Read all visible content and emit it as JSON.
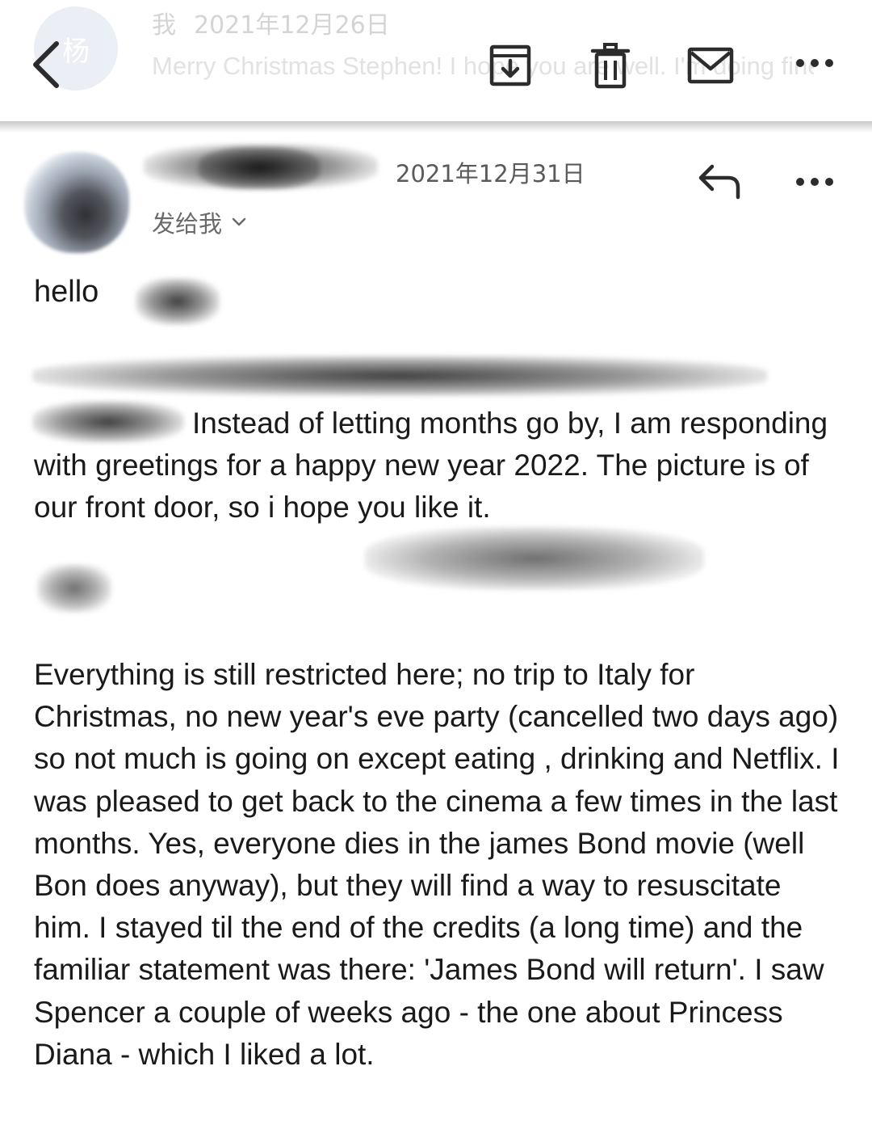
{
  "toolbar": {
    "back_icon": "chevron-left-icon",
    "previous_message": {
      "avatar_char": "杨",
      "sender": "我",
      "date": "2021年12月26日",
      "snippet": "Merry Christmas Stephen! I hope you are well. I'm doing fine. Recent..."
    },
    "actions": [
      "archive-icon",
      "trash-icon",
      "mail-icon",
      "more-icon"
    ]
  },
  "message": {
    "date": "2021年12月31日",
    "recipient_label": "发给我",
    "reply_icon": "reply-icon",
    "more_icon": "more-icon",
    "greeting": "hello",
    "paragraph1": "Instead of letting months go by, I am responding with greetings for a happy new year 2022. The picture is of our front door, so i hope you like it.",
    "paragraph2": "Everything is still restricted here; no trip to Italy for Christmas, no new year's eve party (cancelled two days ago) so not much is going on except eating , drinking and Netflix. I was pleased to get back to the cinema a few times in the last months. Yes, everyone dies in the james Bond movie (well Bon does anyway), but they will find  a way to resuscitate him. I stayed til the end of the credits (a long time) and the familiar statement was there: 'James Bond will return'.  I saw Spencer a couple of weeks ago - the one about Princess Diana - which I liked a lot."
  },
  "colors": {
    "text": "#1a1a1a",
    "secondary": "#5a5a5a",
    "faded_preview": "#d4d4d4",
    "redaction": "#3a3a3a"
  }
}
